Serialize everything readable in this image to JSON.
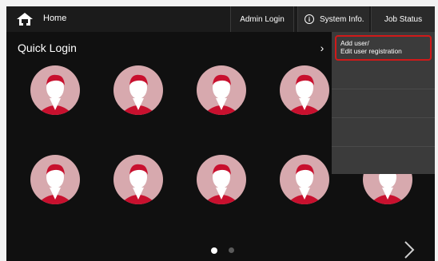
{
  "topbar": {
    "home_label": "Home",
    "admin_login_label": "Admin Login",
    "system_info_label": "System Info.",
    "job_status_label": "Job Status"
  },
  "page": {
    "title": "Quick Login"
  },
  "dropdown": {
    "items": [
      {
        "line1": "Add user/",
        "line2": "Edit user registration"
      }
    ]
  },
  "pagination": {
    "current_page": 1,
    "total_pages": 2
  },
  "icons": {
    "home": "home-icon",
    "info": "info-icon",
    "submenu_arrow": "chevron-right-icon",
    "next": "chevron-right-icon",
    "avatar": "user-avatar-icon"
  },
  "colors": {
    "screen_bg": "#101010",
    "menu_bg": "#3b3b3b",
    "highlight": "#d01919",
    "avatar_bg": "#d7a9ae",
    "avatar_accent": "#c8102e"
  }
}
